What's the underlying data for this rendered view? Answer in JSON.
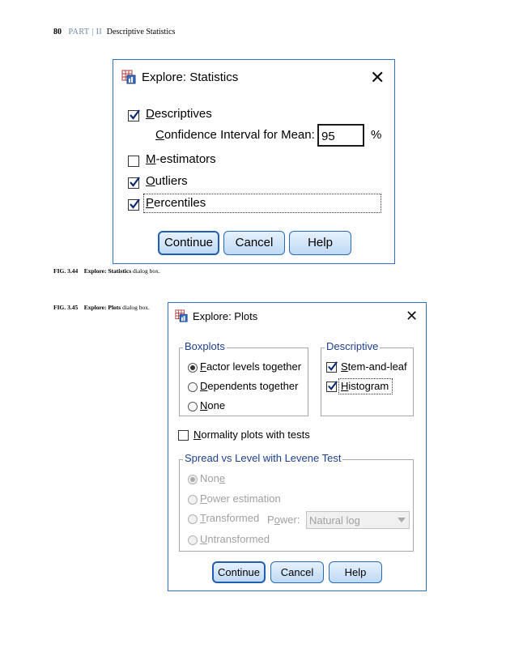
{
  "page_header": {
    "page_number": "80",
    "part_label": "PART",
    "part_number": "II",
    "section_title": "Descriptive Statistics"
  },
  "statistics_dialog": {
    "title": "Explore: Statistics",
    "descriptives": {
      "label": "Descriptives",
      "checked": true
    },
    "confidence_interval": {
      "label": "Confidence Interval for Mean:",
      "value": "95",
      "unit": "%"
    },
    "m_estimators": {
      "label": "M-estimators",
      "checked": false
    },
    "outliers": {
      "label": "Outliers",
      "checked": true
    },
    "percentiles": {
      "label": "Percentiles",
      "checked": true
    },
    "buttons": {
      "continue": "Continue",
      "cancel": "Cancel",
      "help": "Help"
    }
  },
  "caption_344": {
    "number": "FIG. 3.44",
    "bold": "Explore: Statistics",
    "rest": "dialog box."
  },
  "caption_345": {
    "number": "FIG. 3.45",
    "bold": "Explore: Plots",
    "rest": "dialog box."
  },
  "plots_dialog": {
    "title": "Explore: Plots",
    "boxplots": {
      "legend": "Boxplots",
      "options": [
        "Factor levels together",
        "Dependents together",
        "None"
      ],
      "selected": "Factor levels together"
    },
    "descriptive": {
      "legend": "Descriptive",
      "stem_and_leaf": {
        "label": "Stem-and-leaf",
        "checked": true
      },
      "histogram": {
        "label": "Histogram",
        "checked": true
      }
    },
    "normality": {
      "label": "Normality plots with tests",
      "checked": false
    },
    "spread_vs_level": {
      "legend": "Spread vs Level with Levene Test",
      "options": [
        "None",
        "Power estimation",
        "Transformed",
        "Untransformed"
      ],
      "selected": "None",
      "power_label": "Power:",
      "power_value": "Natural log",
      "enabled": false
    },
    "buttons": {
      "continue": "Continue",
      "cancel": "Cancel",
      "help": "Help"
    }
  },
  "colors": {
    "dialog_border": "#2f6ecf",
    "legend_text": "#1d3f8f",
    "button_top": "#e6f1fc",
    "button_bottom": "#bfd9f5"
  },
  "icons": [
    "spss-app-icon",
    "close-icon",
    "checkmark-icon",
    "dropdown-arrow-icon"
  ]
}
